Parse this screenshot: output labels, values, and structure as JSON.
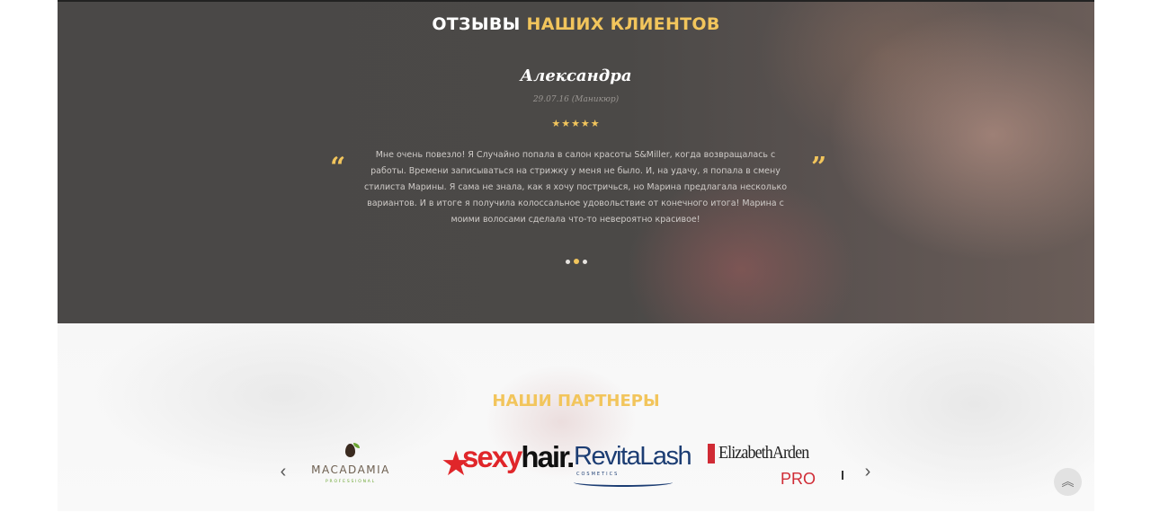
{
  "reviews": {
    "title_part1": "ОТЗЫВЫ",
    "title_part2": "НАШИХ КЛИЕНТОВ",
    "current": {
      "name": "Александра",
      "meta": "29.07.16 (Маникюр)",
      "rating": 5,
      "stars": "★★★★★",
      "text": "Мне очень повезло! Я Случайно попала в салон красоты S&Miller, когда возвращалась с работы. Времени записываться на стрижку у меня не было. И, на удачу, я попала в смену стилиста Марины. Я сама не знала, как я хочу постричься, но Марина предлагала несколько вариантов. И в итоге я получила колоссальное удовольствие от конечного итога! Марина с моими волосами сделала что-то невероятно красивое!"
    },
    "quote_open": "“",
    "quote_close": "”",
    "pagination": {
      "total": 3,
      "active_index": 1
    }
  },
  "partners": {
    "title": "НАШИ ПАРТНЕРЫ",
    "prev_arrow": "‹",
    "next_arrow": "›",
    "logos": [
      {
        "name": "MACADAMIA",
        "sub": "PROFESSIONAL"
      },
      {
        "name_part1": "sexy",
        "name_part2": "hair.",
        "star": "★"
      },
      {
        "name": "RevitaLash",
        "sub": "COSMETICS"
      },
      {
        "name": "ElizabethArden",
        "sub": "PRO"
      }
    ]
  },
  "scroll_top": {
    "icon": "double-chevron-up-icon",
    "glyph": "︽"
  },
  "colors": {
    "accent": "#f2c55c",
    "reviews_bg": "#4a4847",
    "partners_bg": "#f7f7f7"
  }
}
